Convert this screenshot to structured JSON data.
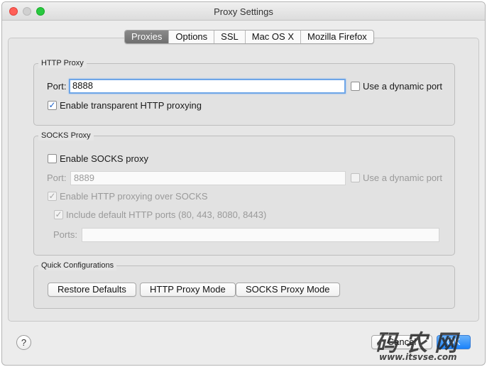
{
  "window": {
    "title": "Proxy Settings"
  },
  "tabs": [
    {
      "label": "Proxies",
      "active": true
    },
    {
      "label": "Options",
      "active": false
    },
    {
      "label": "SSL",
      "active": false
    },
    {
      "label": "Mac OS X",
      "active": false
    },
    {
      "label": "Mozilla Firefox",
      "active": false
    }
  ],
  "http_proxy": {
    "title": "HTTP Proxy",
    "port_label": "Port:",
    "port_value": "8888",
    "dynamic_port_label": "Use a dynamic port",
    "dynamic_port_checked": false,
    "transparent_label": "Enable transparent HTTP proxying",
    "transparent_checked": true
  },
  "socks_proxy": {
    "title": "SOCKS Proxy",
    "enable_label": "Enable SOCKS proxy",
    "enable_checked": false,
    "port_label": "Port:",
    "port_value": "8889",
    "dynamic_port_label": "Use a dynamic port",
    "http_over_socks_label": "Enable HTTP proxying over SOCKS",
    "http_over_socks_checked": true,
    "default_ports_label": "Include default HTTP ports (80, 443, 8080, 8443)",
    "default_ports_checked": true,
    "ports_label": "Ports:",
    "ports_value": ""
  },
  "quick_config": {
    "title": "Quick Configurations",
    "restore_label": "Restore Defaults",
    "http_mode_label": "HTTP Proxy Mode",
    "socks_mode_label": "SOCKS Proxy Mode"
  },
  "footer": {
    "help_label": "?",
    "cancel_label": "Cancel",
    "ok_label": "OK"
  },
  "watermark": {
    "main": "码农网",
    "url": "www.itsvse.com"
  },
  "colors": {
    "accent": "#1a82fb",
    "focus_ring": "#6ea6e8",
    "active_tab": "#7a7a7a"
  }
}
